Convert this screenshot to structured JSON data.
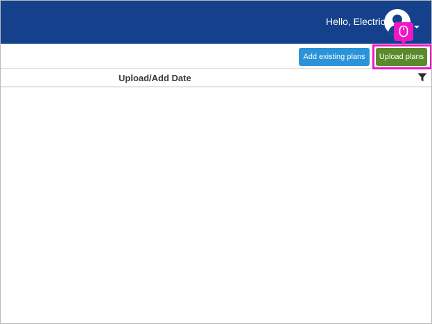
{
  "header": {
    "greeting": "Hello, Electric",
    "avatar_icon": "user-avatar-icon",
    "menu_icon": "caret-down-icon",
    "background_color": "#15418c"
  },
  "toolbar": {
    "add_existing_label": "Add existing plans",
    "upload_label": "Upload plans",
    "add_existing_color": "#2b93d9",
    "upload_color": "#5a8a2a"
  },
  "table": {
    "columns": [
      "Upload/Add Date"
    ],
    "filter_icon": "filter-icon",
    "rows": []
  },
  "overlay": {
    "highlight_color": "#f015c8",
    "cursor_icon": "mouse-icon"
  }
}
